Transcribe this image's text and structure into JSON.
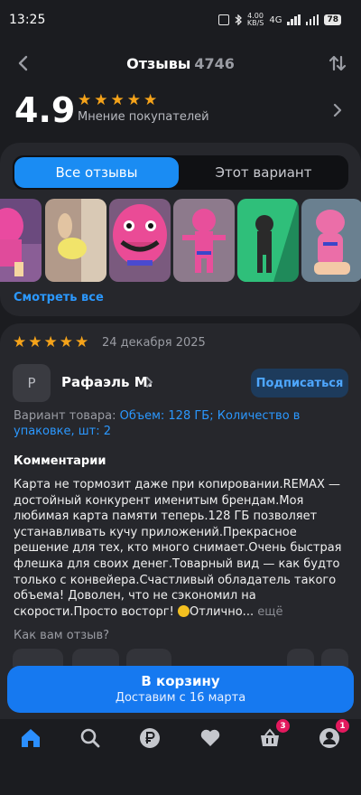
{
  "status_bar": {
    "time": "13:25",
    "speed_value": "4.00",
    "speed_unit": "KB/S",
    "network": "4G",
    "battery": "78"
  },
  "header": {
    "title": "Отзывы",
    "count": "4746"
  },
  "summary": {
    "rating": "4.9",
    "caption": "Мнение покупателей",
    "stars": 5
  },
  "filters": {
    "all": "Все отзывы",
    "variant": "Этот вариант"
  },
  "gallery": {
    "see_all": "Смотреть все",
    "photos": [
      "pink-plush-toy",
      "yellow-toy-closeup",
      "pink-plush-face",
      "pink-plush-full",
      "green-plush-toy",
      "pink-plush-sitting"
    ]
  },
  "review": {
    "stars": 5,
    "date": "24 декабря 2025",
    "avatar_letter": "Р",
    "author": "Рафаэль М.",
    "subscribe": "Подписаться",
    "variant_label": "Вариант товара:",
    "variant_value": "Объем: 128 ГБ; Количество в упаковке, шт: 2",
    "comment_title": "Комментарии",
    "comment_text": "Карта не тормозит даже при копировании.REMAX — достойный конкурент именитым брендам.Моя любимая карта памяти теперь.128 ГБ позволяет устанавливать кучу приложений.Прекрасное решение для тех, кто много снимает.Очень быстрая флешка для своих денег.Товарный вид — как будто только с конвейера.Счастливый обладатель такого объема! Доволен, что не сэкономил на скорости.Просто восторг!",
    "comment_tail": "Отлично...",
    "more": "ещё",
    "question": "Как вам отзыв?"
  },
  "cart": {
    "label": "В корзину",
    "delivery": "Доставим с 16 марта"
  },
  "tabbar": {
    "items": [
      "home-icon",
      "search-icon",
      "ruble-icon",
      "heart-icon",
      "basket-icon",
      "profile-icon"
    ],
    "basket_badge": "3",
    "profile_badge": "1",
    "active_color": "#2b8fff",
    "inactive_color": "#c5c7cd"
  },
  "colors": {
    "accent": "#1a8cf3",
    "star": "#f5a31a",
    "badge": "#e3195e"
  }
}
